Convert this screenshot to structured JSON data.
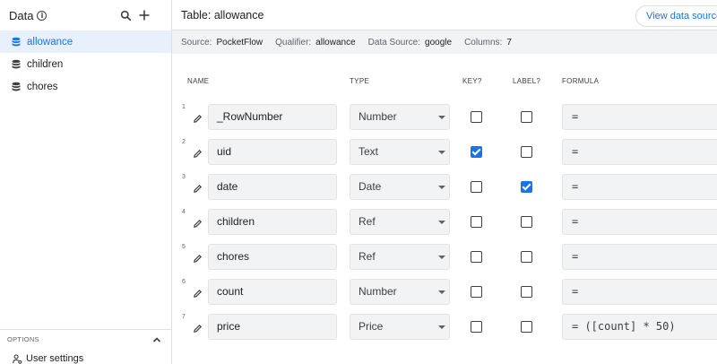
{
  "sidebar": {
    "title": "Data",
    "items": [
      {
        "label": "allowance",
        "active": true
      },
      {
        "label": "children",
        "active": false
      },
      {
        "label": "chores",
        "active": false
      }
    ],
    "options_label": "OPTIONS",
    "user_settings_label": "User settings"
  },
  "header": {
    "title": "Table: allowance",
    "view_source_button": "View data source"
  },
  "meta": {
    "source_key": "Source:",
    "source_val": "PocketFlow",
    "qualifier_key": "Qualifier:",
    "qualifier_val": "allowance",
    "datasource_key": "Data Source:",
    "datasource_val": "google",
    "columns_key": "Columns:",
    "columns_val": "7"
  },
  "columns_header": {
    "name": "NAME",
    "type": "TYPE",
    "key": "KEY?",
    "label": "LABEL?",
    "formula": "FORMULA"
  },
  "rows": [
    {
      "num": "1",
      "name": "_RowNumber",
      "type": "Number",
      "key": false,
      "label": false,
      "formula": "="
    },
    {
      "num": "2",
      "name": "uid",
      "type": "Text",
      "key": true,
      "label": false,
      "formula": "="
    },
    {
      "num": "3",
      "name": "date",
      "type": "Date",
      "key": false,
      "label": true,
      "formula": "="
    },
    {
      "num": "4",
      "name": "children",
      "type": "Ref",
      "key": false,
      "label": false,
      "formula": "="
    },
    {
      "num": "5",
      "name": "chores",
      "type": "Ref",
      "key": false,
      "label": false,
      "formula": "="
    },
    {
      "num": "6",
      "name": "count",
      "type": "Number",
      "key": false,
      "label": false,
      "formula": "="
    },
    {
      "num": "7",
      "name": "price",
      "type": "Price",
      "key": false,
      "label": false,
      "formula": "= ([count] * 50)"
    }
  ],
  "colors": {
    "accent": "#1a73e8",
    "active_bg": "#e8f0fe",
    "field_bg": "#f1f3f4"
  }
}
